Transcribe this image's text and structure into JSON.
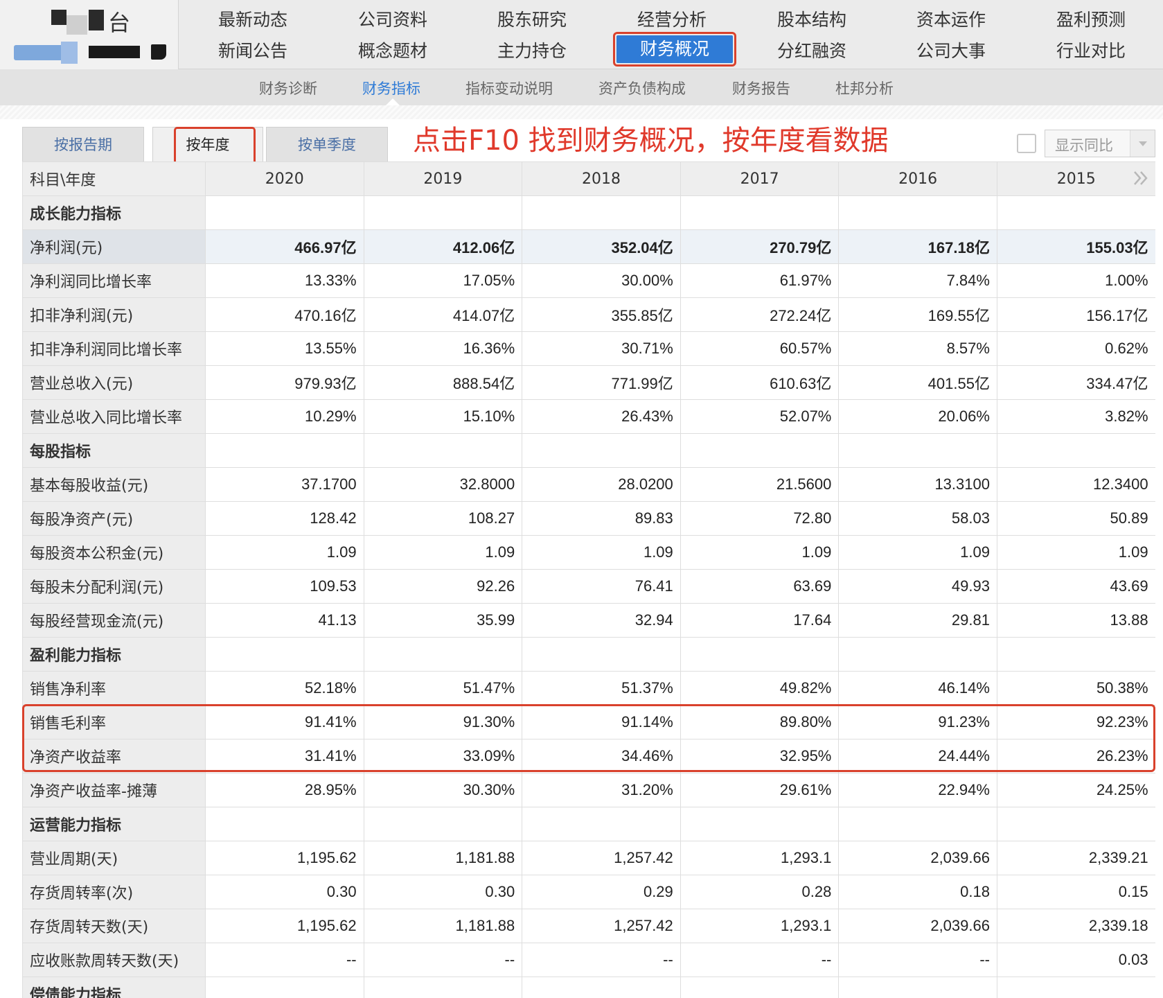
{
  "header": {
    "logo_char": "台",
    "nav_row1": [
      "最新动态",
      "公司资料",
      "股东研究",
      "经营分析",
      "股本结构",
      "资本运作",
      "盈利预测"
    ],
    "nav_row2": [
      "新闻公告",
      "概念题材",
      "主力持仓",
      "财务概况",
      "分红融资",
      "公司大事",
      "行业对比"
    ],
    "active": "财务概况"
  },
  "subnav": {
    "items": [
      "财务诊断",
      "财务指标",
      "指标变动说明",
      "资产负债构成",
      "财务报告",
      "杜邦分析"
    ],
    "active": "财务指标"
  },
  "tabs": {
    "items": [
      "按报告期",
      "按年度",
      "按单季度"
    ],
    "active": "按年度"
  },
  "annotation": "点击F10 找到财务概况，按年度看数据",
  "yoy": {
    "label": "显示同比"
  },
  "accent_colors": {
    "highlight": "#d9412c",
    "active_blue": "#2f7bd6",
    "annotation": "#e0392b"
  },
  "table": {
    "corner_label": "科目\\年度",
    "years": [
      "2020",
      "2019",
      "2018",
      "2017",
      "2016",
      "2015"
    ],
    "rows": [
      {
        "label": "成长能力指标",
        "section": true,
        "values": [
          "",
          "",
          "",
          "",
          "",
          ""
        ]
      },
      {
        "label": "净利润(元)",
        "highlight": true,
        "values": [
          "466.97亿",
          "412.06亿",
          "352.04亿",
          "270.79亿",
          "167.18亿",
          "155.03亿"
        ]
      },
      {
        "label": "净利润同比增长率",
        "values": [
          "13.33%",
          "17.05%",
          "30.00%",
          "61.97%",
          "7.84%",
          "1.00%"
        ]
      },
      {
        "label": "扣非净利润(元)",
        "values": [
          "470.16亿",
          "414.07亿",
          "355.85亿",
          "272.24亿",
          "169.55亿",
          "156.17亿"
        ]
      },
      {
        "label": "扣非净利润同比增长率",
        "values": [
          "13.55%",
          "16.36%",
          "30.71%",
          "60.57%",
          "8.57%",
          "0.62%"
        ]
      },
      {
        "label": "营业总收入(元)",
        "values": [
          "979.93亿",
          "888.54亿",
          "771.99亿",
          "610.63亿",
          "401.55亿",
          "334.47亿"
        ]
      },
      {
        "label": "营业总收入同比增长率",
        "values": [
          "10.29%",
          "15.10%",
          "26.43%",
          "52.07%",
          "20.06%",
          "3.82%"
        ]
      },
      {
        "label": "每股指标",
        "section": true,
        "values": [
          "",
          "",
          "",
          "",
          "",
          ""
        ]
      },
      {
        "label": "基本每股收益(元)",
        "values": [
          "37.1700",
          "32.8000",
          "28.0200",
          "21.5600",
          "13.3100",
          "12.3400"
        ]
      },
      {
        "label": "每股净资产(元)",
        "values": [
          "128.42",
          "108.27",
          "89.83",
          "72.80",
          "58.03",
          "50.89"
        ]
      },
      {
        "label": "每股资本公积金(元)",
        "values": [
          "1.09",
          "1.09",
          "1.09",
          "1.09",
          "1.09",
          "1.09"
        ]
      },
      {
        "label": "每股未分配利润(元)",
        "values": [
          "109.53",
          "92.26",
          "76.41",
          "63.69",
          "49.93",
          "43.69"
        ]
      },
      {
        "label": "每股经营现金流(元)",
        "values": [
          "41.13",
          "35.99",
          "32.94",
          "17.64",
          "29.81",
          "13.88"
        ]
      },
      {
        "label": "盈利能力指标",
        "section": true,
        "values": [
          "",
          "",
          "",
          "",
          "",
          ""
        ]
      },
      {
        "label": "销售净利率",
        "values": [
          "52.18%",
          "51.47%",
          "51.37%",
          "49.82%",
          "46.14%",
          "50.38%"
        ]
      },
      {
        "label": "销售毛利率",
        "values": [
          "91.41%",
          "91.30%",
          "91.14%",
          "89.80%",
          "91.23%",
          "92.23%"
        ]
      },
      {
        "label": "净资产收益率",
        "values": [
          "31.41%",
          "33.09%",
          "34.46%",
          "32.95%",
          "24.44%",
          "26.23%"
        ]
      },
      {
        "label": "净资产收益率-摊薄",
        "values": [
          "28.95%",
          "30.30%",
          "31.20%",
          "29.61%",
          "22.94%",
          "24.25%"
        ]
      },
      {
        "label": "运营能力指标",
        "section": true,
        "values": [
          "",
          "",
          "",
          "",
          "",
          ""
        ]
      },
      {
        "label": "营业周期(天)",
        "values": [
          "1,195.62",
          "1,181.88",
          "1,257.42",
          "1,293.1",
          "2,039.66",
          "2,339.21"
        ]
      },
      {
        "label": "存货周转率(次)",
        "values": [
          "0.30",
          "0.30",
          "0.29",
          "0.28",
          "0.18",
          "0.15"
        ]
      },
      {
        "label": "存货周转天数(天)",
        "values": [
          "1,195.62",
          "1,181.88",
          "1,257.42",
          "1,293.1",
          "2,039.66",
          "2,339.18"
        ]
      },
      {
        "label": "应收账款周转天数(天)",
        "values": [
          "--",
          "--",
          "--",
          "--",
          "--",
          "0.03"
        ]
      },
      {
        "label": "偿债能力指标",
        "section": true,
        "values": [
          "",
          "",
          "",
          "",
          "",
          ""
        ]
      }
    ]
  }
}
